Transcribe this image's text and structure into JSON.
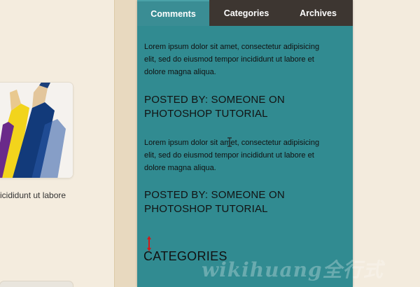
{
  "tabs": [
    {
      "label": "Comments",
      "active": true
    },
    {
      "label": "Categories",
      "active": false
    },
    {
      "label": "Archives",
      "active": false
    }
  ],
  "comments": [
    {
      "text_lines": [
        "Lorem ipsum dolor sit amet, consectetur adipisicing",
        "elit, sed do eiusmod tempor incididunt ut labore et",
        "dolore magna aliqua."
      ],
      "posted_lines": [
        "POSTED BY: SOMEONE ON",
        "PHOTOSHOP TUTORIAL"
      ]
    },
    {
      "text_lines": [
        "Lorem ipsum dolor sit amet, consectetur adipisicing",
        "elit, sed do eiusmod tempor incididunt ut labore et",
        "dolore magna aliqua."
      ],
      "posted_lines": [
        "POSTED BY: SOMEONE ON",
        "PHOTOSHOP TUTORIAL"
      ]
    }
  ],
  "categories_heading": "CATEGORIES",
  "left_caption": "icididunt ut labore",
  "watermark": "wikihuang全行式",
  "colors": {
    "widget_bg": "#318b91",
    "tab_bar_bg": "#3d3631",
    "active_tab_bg": "#3a8d94",
    "page_bg": "#f3ebdd",
    "arrow": "#d11a1a"
  },
  "icons": {
    "thumbnail": "colored-pencils-image",
    "annotation": "red-up-down-arrow-icon",
    "cursor": "text-cursor-icon"
  }
}
